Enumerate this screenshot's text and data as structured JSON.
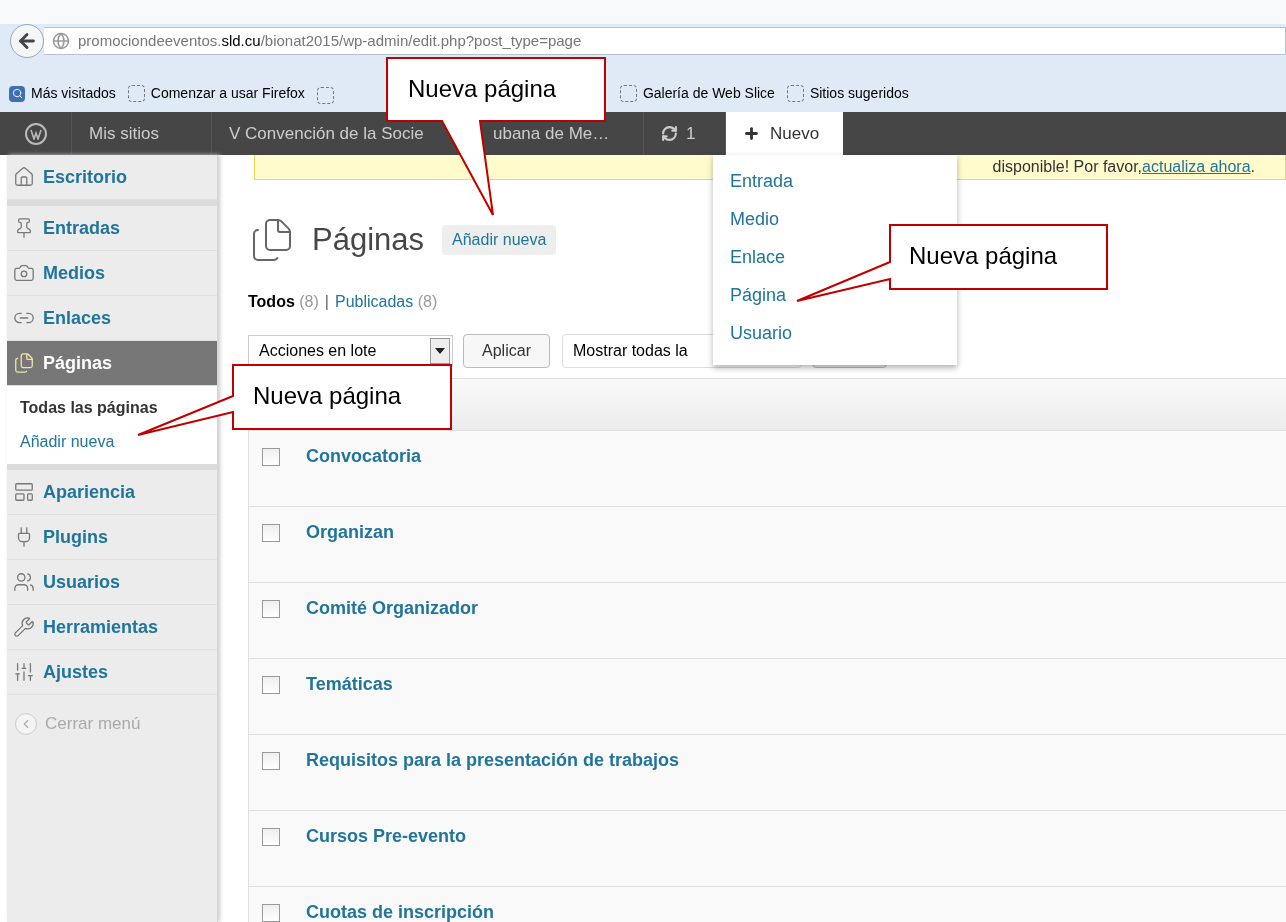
{
  "browser": {
    "url": "promociondeeventos.**sld.cu**/bionat2015/wp-admin/edit.php?post_type=page",
    "bookmarks": [
      {
        "kind": "search",
        "label": "Más visitados"
      },
      {
        "kind": "page",
        "label": "Comenzar a usar Firefox"
      },
      {
        "kind": "page"
      },
      {
        "kind": "page",
        "label": "Galería de Web Slice"
      },
      {
        "kind": "page",
        "label": "Sitios sugeridos"
      }
    ]
  },
  "admin_bar": {
    "items": [
      {
        "kind": "logo",
        "selected": false
      },
      {
        "kind": "text",
        "label": "Mis sitios",
        "selected": false
      },
      {
        "kind": "site",
        "label": "V Convención de la Socie",
        "label_end": "ubana de Me…",
        "selected": false
      },
      {
        "kind": "updates",
        "label": "1",
        "selected": false
      },
      {
        "kind": "new",
        "label": "Nuevo",
        "selected": true
      }
    ],
    "new_menu": [
      "Entrada",
      "Medio",
      "Enlace",
      "Página",
      "Usuario"
    ]
  },
  "sidebar": {
    "sections": [
      {
        "items": [
          {
            "label": "Escritorio",
            "selected": false
          }
        ]
      },
      {
        "items": [
          {
            "label": "Entradas",
            "selected": false
          },
          {
            "label": "Medios",
            "selected": false
          },
          {
            "label": "Enlaces",
            "selected": false
          },
          {
            "label": "Páginas",
            "selected": true,
            "children": [
              {
                "label": "Todas las páginas",
                "selected": true
              },
              {
                "label": "Añadir nueva",
                "selected": false
              }
            ]
          }
        ]
      },
      {
        "items": [
          {
            "label": "Apariencia",
            "selected": false
          },
          {
            "label": "Plugins",
            "selected": false
          },
          {
            "label": "Usuarios",
            "selected": false
          },
          {
            "label": "Herramientas",
            "selected": false
          },
          {
            "label": "Ajustes",
            "selected": false
          }
        ]
      }
    ],
    "collapse": "Cerrar menú"
  },
  "notice": {
    "text": "disponible! Por favor, ",
    "link": "actualiza ahora",
    "end": "."
  },
  "page": {
    "title": "Páginas",
    "add_button": "Añadir nueva",
    "filters": [
      {
        "label": "Todos",
        "count": "(8)",
        "selected": true
      },
      {
        "label": "Publicadas",
        "count": "(8)",
        "selected": false
      }
    ],
    "filter_separator": "|",
    "bulk_actions": "Acciones en lote",
    "apply": "Aplicar",
    "date_filter": "Mostrar todas la"
  },
  "table": {
    "rows": [
      {
        "title": "Convocatoria",
        "checked": false
      },
      {
        "title": "Organizan",
        "checked": false
      },
      {
        "title": "Comité Organizador",
        "checked": false
      },
      {
        "title": "Temáticas",
        "checked": false
      },
      {
        "title": "Requisitos para la presentación de trabajos",
        "checked": false
      },
      {
        "title": "Cursos Pre-evento",
        "checked": false
      },
      {
        "title": "Cuotas de inscripción",
        "checked": false
      }
    ]
  },
  "callouts": [
    {
      "text": "Nueva página"
    },
    {
      "text": "Nueva página"
    },
    {
      "text": "Nueva página"
    }
  ]
}
